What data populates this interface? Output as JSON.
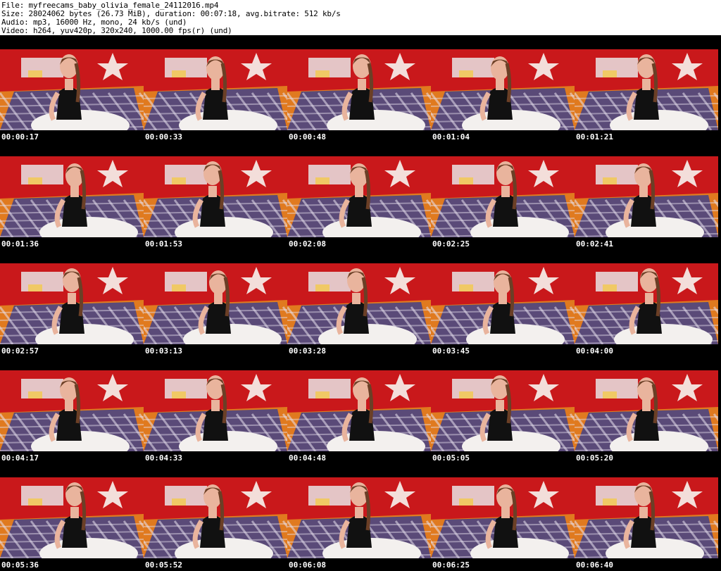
{
  "header": {
    "file_line": "File: myfreecams_baby_olivia_female_24112016.mp4",
    "size_line": "Size: 28024062 bytes (26.73 MiB), duration: 00:07:18, avg.bitrate: 512 kb/s",
    "audio_line": "Audio: mp3, 16000 Hz, mono, 24 kb/s (und)",
    "video_line": "Video: h264, yuv420p, 320x240, 1000.00 fps(r) (und)"
  },
  "thumbnails": [
    {
      "timestamp": "00:00:17"
    },
    {
      "timestamp": "00:00:33"
    },
    {
      "timestamp": "00:00:48"
    },
    {
      "timestamp": "00:01:04"
    },
    {
      "timestamp": "00:01:21"
    },
    {
      "timestamp": "00:01:36"
    },
    {
      "timestamp": "00:01:53"
    },
    {
      "timestamp": "00:02:08"
    },
    {
      "timestamp": "00:02:25"
    },
    {
      "timestamp": "00:02:41"
    },
    {
      "timestamp": "00:02:57"
    },
    {
      "timestamp": "00:03:13"
    },
    {
      "timestamp": "00:03:28"
    },
    {
      "timestamp": "00:03:45"
    },
    {
      "timestamp": "00:04:00"
    },
    {
      "timestamp": "00:04:17"
    },
    {
      "timestamp": "00:04:33"
    },
    {
      "timestamp": "00:04:48"
    },
    {
      "timestamp": "00:05:05"
    },
    {
      "timestamp": "00:05:20"
    },
    {
      "timestamp": "00:05:36"
    },
    {
      "timestamp": "00:05:52"
    },
    {
      "timestamp": "00:06:08"
    },
    {
      "timestamp": "00:06:25"
    },
    {
      "timestamp": "00:06:40"
    }
  ],
  "colors": {
    "wall": "#c9181b",
    "floor": "#e07a1f",
    "blanket": "#5a4a78",
    "plaid_line": "#e8e2ef",
    "top": "#111111",
    "skin": "#e9b49d",
    "hair": "#6b3f26",
    "pillow": "#f3f0ee",
    "star": "#f7f4f0"
  }
}
